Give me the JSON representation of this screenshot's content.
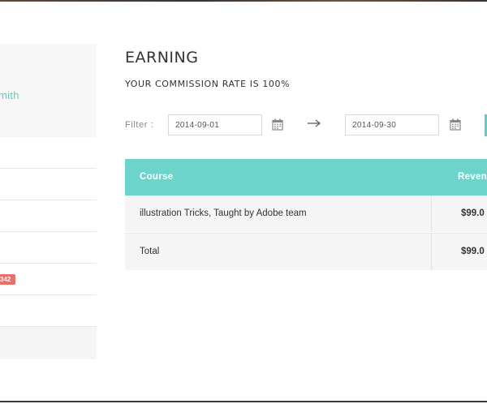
{
  "sidebar": {
    "user_name_partial": "mith",
    "badge_text": "342"
  },
  "main": {
    "title": "EARNING",
    "commission_text": "YOUR COMMISSION RATE IS 100%",
    "filter": {
      "label": "Filter :",
      "start_date": "2014-09-01",
      "end_date": "2014-09-30",
      "calendar_icon": "calendar-icon",
      "arrow_icon": "arrow-right-icon"
    },
    "table": {
      "headers": {
        "course": "Course",
        "revenue": "Reven"
      },
      "rows": [
        {
          "course": "illustration Tricks, Taught by Adobe team",
          "revenue": "$99.0"
        },
        {
          "course": "Total",
          "revenue": "$99.0"
        }
      ]
    }
  },
  "colors": {
    "accent": "#6dd4cc",
    "name_text": "#5bcfc6",
    "badge": "#e8706b"
  }
}
